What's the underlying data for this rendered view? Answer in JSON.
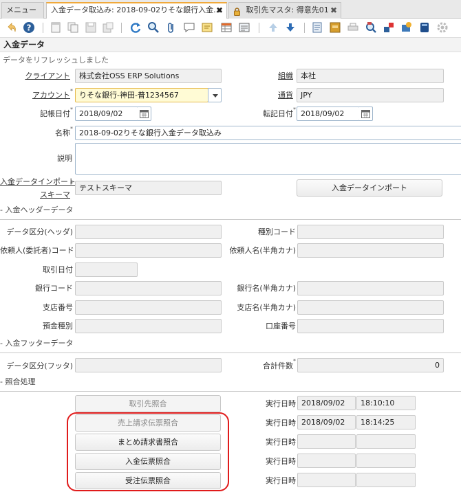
{
  "tabs": [
    {
      "label": "メニュー"
    },
    {
      "label": "入金データ取込み: 2018-09-02りそな銀行入金..."
    },
    {
      "label": "取引先マスタ: 得意先01"
    }
  ],
  "toolbar": {
    "icons": [
      "undo-icon",
      "help-icon",
      "new-record-icon",
      "copy-record-icon",
      "save-icon",
      "save-new-icon",
      "refresh-icon",
      "find-icon",
      "attachment-icon",
      "chat-icon",
      "note-icon",
      "grid-toggle-icon",
      "detail-icon",
      "previous-record-icon",
      "next-record-icon",
      "report-icon",
      "archive-icon",
      "print-icon",
      "zoom-across-icon",
      "request-icon",
      "workflow-icon",
      "product-info-icon",
      "settings-icon"
    ]
  },
  "window_title": "入金データ",
  "status_message": "データをリフレッシュしました",
  "header": {
    "client_label": "クライアント",
    "client_value": "株式会社OSS ERP Solutions",
    "org_label": "組織",
    "org_value": "本社",
    "account_label": "アカウント",
    "account_value": "りそな銀行-神田-普1234567",
    "currency_label": "通貨",
    "currency_value": "JPY",
    "date_acct_label": "記帳日付",
    "date_acct_value": "2018/09/02",
    "date_trx_label": "転記日付",
    "date_trx_value": "2018/09/02",
    "name_label": "名称",
    "name_value": "2018-09-02りそな銀行入金データ取込み",
    "desc_label": "説明",
    "desc_value": "",
    "schema_label_1": "入金データインポート",
    "schema_label_2": "スキーマ",
    "schema_value": "テストスキーマ",
    "import_button": "入金データインポート"
  },
  "header_data": {
    "section_title": "- 入金ヘッダーデータ",
    "data_type_label": "データ区分(ヘッダ)",
    "kind_code_label": "種別コード",
    "requester_code_label": "依頼人(委託者)コード",
    "requester_name_label": "依頼人名(半角カナ)",
    "trx_date_label": "取引日付",
    "bank_code_label": "銀行コード",
    "bank_name_label": "銀行名(半角カナ)",
    "branch_no_label": "支店番号",
    "branch_name_label": "支店名(半角カナ)",
    "deposit_type_label": "預金種別",
    "account_no_label": "口座番号"
  },
  "footer_data": {
    "section_title": "- 入金フッターデータ",
    "data_type_label": "データ区分(フッタ)",
    "total_count_label": "合計件数",
    "total_count_value": "0"
  },
  "matching": {
    "section_title": "- 照合処理",
    "exec_label": "実行日時",
    "rows": [
      {
        "button": "取引先照合",
        "date": "2018/09/02",
        "time": "18:10:10",
        "disabled": true
      },
      {
        "button": "売上請求伝票照合",
        "date": "2018/09/02",
        "time": "18:14:25",
        "disabled": true
      },
      {
        "button": "まとめ請求書照合",
        "date": "",
        "time": "",
        "disabled": false
      },
      {
        "button": "入金伝票照合",
        "date": "",
        "time": "",
        "disabled": false
      },
      {
        "button": "受注伝票照合",
        "date": "",
        "time": "",
        "disabled": false
      }
    ]
  },
  "colors": {
    "active_tab_accent": "#f0a93b",
    "highlight": "#e01b1b",
    "mandatory_field": "#fffbd5"
  }
}
